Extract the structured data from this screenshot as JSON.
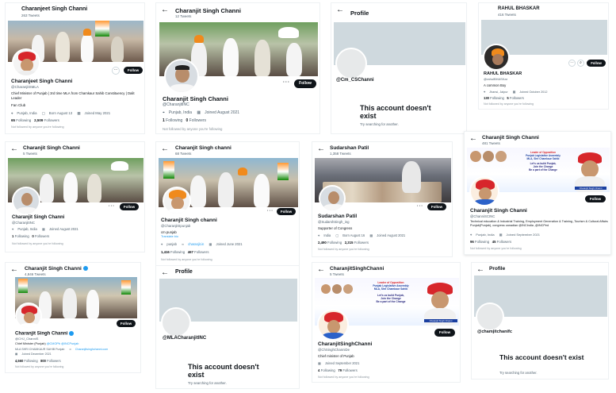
{
  "cards": {
    "c1": {
      "header_name": "Charanjeet Singh Channi",
      "header_sub": "263 Tweets",
      "name": "Charanjeet Singh Channi",
      "handle": "@CharanjitSMLA",
      "bio": "Chief Minister of Punjab | 3rd time MLA from Chamkaur Sahib Constituency | Dalit Leader",
      "bio2": "Fan Club",
      "location": "Punjab, India",
      "born": "Born August 13",
      "joined": "Joined May 2021",
      "following_count": "65",
      "following_label": "Following",
      "followers_count": "2,509",
      "followers_label": "Followers",
      "not_followed": "Not followed by anyone you're following",
      "follow_label": "Follow"
    },
    "c2": {
      "header_name": "Charanjit Singh Channi",
      "header_sub": "12 Tweets",
      "name": "Charanjit Singh Channi",
      "handle": "@CharanjitINC",
      "location": "Punjab, India",
      "joined": "Joined August 2021",
      "following_count": "1",
      "following_label": "Following",
      "followers_count": "0",
      "followers_label": "Followers",
      "not_followed": "Not followed by anyone you're following",
      "follow_label": "Follow"
    },
    "c3": {
      "header_title": "Profile",
      "handle": "@Cm_CSChanni",
      "na_title": "This account doesn't exist",
      "na_sub": "Try searching for another."
    },
    "c4": {
      "header_name": "RAHUL BHASKAR",
      "header_sub": "416 Tweets",
      "name": "RAHUL BHASKAR",
      "handle": "@rahulBHASKar",
      "bio": "A common Boy",
      "location": "Jhansi, Jaipur",
      "joined": "Joined October 2012",
      "following_count": "130",
      "following_label": "Following",
      "followers_count": "5",
      "followers_label": "Followers",
      "not_followed": "Not followed by anyone you're following",
      "follow_label": "Follow"
    },
    "c5": {
      "header_name": "Charanjit Singh Channi",
      "header_sub": "5 Tweets",
      "name": "Charanjit Singh Channi",
      "handle": "@CharanjitINC",
      "location": "Punjab, India",
      "joined": "Joined August 2021",
      "following_count": "1",
      "following_label": "Following",
      "followers_count": "0",
      "followers_label": "Followers",
      "not_followed": "Not followed by anyone you're following",
      "follow_label": "Follow"
    },
    "c6": {
      "header_name": "Charanjit Singh channi",
      "header_sub": "68 Tweets",
      "name": "Charanjit Singh channi",
      "handle": "@CharanjitSpunjab",
      "bio": "cm punjab",
      "bio_link": "Translate bio",
      "location": "punjab",
      "website": "charanjit.in",
      "joined": "Joined June 2021",
      "following_count": "1,416",
      "following_label": "Following",
      "followers_count": "467",
      "followers_label": "Followers",
      "not_followed": "Not followed by anyone you're following",
      "follow_label": "Follow"
    },
    "c7": {
      "header_name": "Sudarshan Patil",
      "header_sub": "1,358 Tweets",
      "name": "Sudarshan Patil",
      "handle": "@SudarshSingh_ing",
      "bio": "Supporter of Congress",
      "location": "India",
      "born": "Born August 16",
      "joined": "Joined August 2021",
      "following_count": "2,490",
      "following_label": "Following",
      "followers_count": "2,315",
      "followers_label": "Followers",
      "not_followed": "Not followed by anyone you're following",
      "follow_label": "Follow"
    },
    "c8": {
      "header_name": "Charanjit Singh Channi",
      "header_sub": "481 Tweets",
      "name": "Charanjit Singh Channi",
      "handle": "@ChanniSCINC",
      "bio": "Technical education & Industrial Training, Employment Generation & Training ,Tourism & Cultural Affairs Punjab(Punjab), congress canadian @INCIndia ,@INCPed",
      "location": "Punjab, India",
      "joined": "Joined September 2021",
      "following_count": "96",
      "following_label": "Following",
      "followers_count": "45",
      "followers_label": "Followers",
      "not_followed": "Not followed by anyone you're following",
      "follow_label": "Follow",
      "poster_line1": "Leader of Opposition",
      "poster_line2": "Punjab Legislative Assembly",
      "poster_line3": "MLA, Shri Chamkaur Sahib",
      "poster_line4": "Let's us build Punjab,",
      "poster_line5": "Join the Change",
      "poster_line6": "Be a part of the Change",
      "poster_caption": "Charanjit Singh Channi"
    },
    "c9": {
      "header_name": "Charanjit Singh Channi",
      "header_sub": "4,846 Tweets",
      "name": "Charanjit Singh Channi",
      "handle": "@CHJ_ChanniS",
      "bio": "Chief Minister (Punjab)",
      "bio_tags": "@CMOPb @INCPunjab",
      "bio2": "MLA SHRI CHAMKAUR SAHIB Punjab",
      "website": "Charanjitsinghchanni.com",
      "joined": "Joined December 2021",
      "following_count": "4,560",
      "following_label": "Following",
      "followers_count": "800",
      "followers_label": "Followers",
      "not_followed": "Not followed by anyone you're following",
      "follow_label": "Follow"
    },
    "c10": {
      "header_title": "Profile",
      "handle": "@MLACharanjitINC",
      "na_title": "This account doesn't exist",
      "na_sub": "Try searching for another."
    },
    "c11": {
      "header_name": "CharanjitSinghChanni",
      "header_sub": "5 Tweets",
      "name": "CharanjitSinghChanni",
      "handle": "@ChSinghChanniDe",
      "bio": "Chief minister of Punjab",
      "joined": "Joined September 2021",
      "following_count": "4",
      "following_label": "Following",
      "followers_count": "79",
      "followers_label": "Followers",
      "not_followed": "Not followed by anyone you're following",
      "follow_label": "Follow",
      "poster_line1": "Leader of Opposition",
      "poster_line2": "Punjab Legislative Assembly",
      "poster_line3": "MLA, Shri Chamkaur Sahib",
      "poster_line4": "Let's us build Punjab,",
      "poster_line5": "Join the Change",
      "poster_line6": "Be a part of the Change",
      "poster_caption": "Charanjit Singh Channi"
    },
    "c12": {
      "header_title": "Profile",
      "handle": "@chamjitchanifc",
      "na_title": "This account doesn't exist",
      "na_sub": "Try searching for another."
    }
  },
  "icons": {
    "back": "arrow-left-icon",
    "more": "more-dots-icon",
    "location": "location-pin-icon",
    "calendar": "calendar-icon",
    "link": "link-icon"
  },
  "colors": {
    "follow_button": "#0f1419",
    "secondary_text": "#536471",
    "link": "#1d9bf0",
    "placeholder_grey": "#cfd9de",
    "turban_orange": "#f08a1c",
    "turban_red": "#d7262b"
  }
}
